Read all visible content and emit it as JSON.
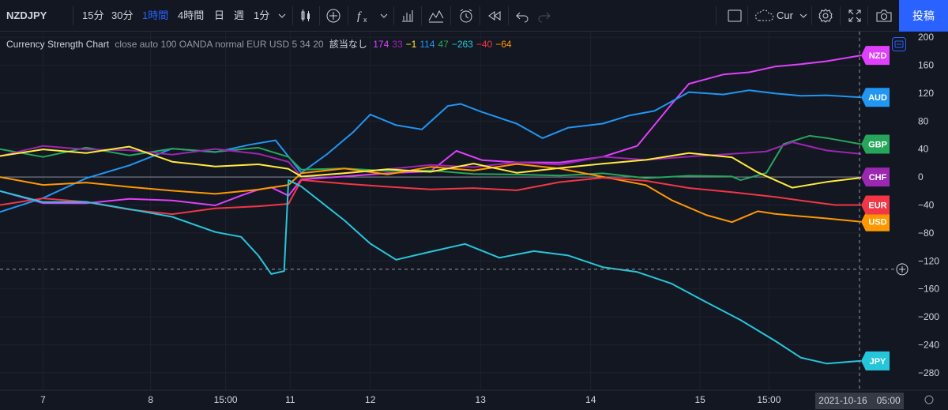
{
  "toolbar": {
    "symbol": "NZDJPY",
    "intervals": [
      "15分",
      "30分",
      "1時間",
      "4時間",
      "日",
      "週",
      "1分"
    ],
    "active_interval": "1時間",
    "cloud_label": "Cur",
    "post_label": "投稿",
    "icons": [
      "candles-icon",
      "add-indicator-icon",
      "fx-icon",
      "bar-chart-icon",
      "compare-icon",
      "alert-icon",
      "replay-icon",
      "undo-icon",
      "redo-icon",
      "layout-icon",
      "cloud-icon",
      "settings-icon",
      "fullscreen-icon",
      "camera-icon"
    ]
  },
  "legend": {
    "title": "Currency Strength Chart",
    "params": "close auto 100 OANDA normal EUR USD 5 34 20",
    "na": "該当なし",
    "values": [
      {
        "text": "174",
        "color": "#e040fb"
      },
      {
        "text": "33",
        "color": "#9c27b0"
      },
      {
        "text": "−1",
        "color": "#ffeb3b"
      },
      {
        "text": "114",
        "color": "#2196f3"
      },
      {
        "text": "47",
        "color": "#26a65b"
      },
      {
        "text": "−263",
        "color": "#26c6da"
      },
      {
        "text": "−40",
        "color": "#f23645"
      },
      {
        "text": "−64",
        "color": "#ff9800"
      }
    ]
  },
  "chart_data": {
    "type": "line",
    "ylim": [
      -305,
      208
    ],
    "yticks": [
      200,
      160,
      120,
      80,
      40,
      0,
      -40,
      -80,
      -120,
      -160,
      -200,
      -240,
      -280
    ],
    "xticks": [
      {
        "label": "7",
        "pos": 0.05
      },
      {
        "label": "8",
        "pos": 0.175
      },
      {
        "label": "15:00",
        "pos": 0.262
      },
      {
        "label": "11",
        "pos": 0.337
      },
      {
        "label": "12",
        "pos": 0.43
      },
      {
        "label": "13",
        "pos": 0.558
      },
      {
        "label": "14",
        "pos": 0.686
      },
      {
        "label": "15",
        "pos": 0.813
      },
      {
        "label": "15:00",
        "pos": 0.893
      }
    ],
    "crosshair": {
      "price": "−132",
      "time": "2021-10-16　05:00"
    },
    "series": [
      {
        "name": "NZD",
        "color": "#e040fb",
        "anchor": 168,
        "label_y": 174,
        "x": [
          0,
          0.05,
          0.1,
          0.15,
          0.2,
          0.25,
          0.28,
          0.3,
          0.315,
          0.335,
          0.35,
          0.4,
          0.45,
          0.5,
          0.53,
          0.56,
          0.6,
          0.65,
          0.7,
          0.74,
          0.78,
          0.8,
          0.84,
          0.87,
          0.9,
          0.93,
          0.96,
          1
        ],
        "values": [
          -20,
          -38,
          -40,
          -35,
          -38,
          -45,
          -30,
          -20,
          -15,
          -25,
          0,
          5,
          10,
          12,
          40,
          25,
          20,
          18,
          25,
          40,
          100,
          130,
          145,
          150,
          160,
          165,
          170,
          174
        ]
      },
      {
        "name": "AUD",
        "color": "#2196f3",
        "anchor": 114,
        "label_y": 114,
        "x": [
          0,
          0.05,
          0.1,
          0.15,
          0.2,
          0.25,
          0.29,
          0.32,
          0.335,
          0.35,
          0.38,
          0.41,
          0.43,
          0.46,
          0.49,
          0.52,
          0.535,
          0.56,
          0.6,
          0.63,
          0.66,
          0.7,
          0.73,
          0.76,
          0.8,
          0.84,
          0.87,
          0.9,
          0.93,
          0.96,
          1
        ],
        "values": [
          -50,
          -30,
          0,
          20,
          45,
          40,
          50,
          55,
          30,
          5,
          30,
          60,
          85,
          70,
          65,
          100,
          105,
          95,
          80,
          60,
          75,
          80,
          90,
          95,
          120,
          115,
          120,
          115,
          112,
          114,
          114
        ]
      },
      {
        "name": "GBP",
        "color": "#26a65b",
        "anchor": 47,
        "label_y": 47,
        "x": [
          0,
          0.05,
          0.1,
          0.15,
          0.2,
          0.25,
          0.3,
          0.335,
          0.35,
          0.4,
          0.45,
          0.5,
          0.55,
          0.6,
          0.65,
          0.7,
          0.75,
          0.8,
          0.85,
          0.86,
          0.89,
          0.91,
          0.94,
          0.96,
          1
        ],
        "values": [
          40,
          30,
          45,
          35,
          45,
          40,
          45,
          30,
          10,
          10,
          5,
          5,
          0,
          0,
          0,
          5,
          0,
          5,
          5,
          0,
          10,
          50,
          60,
          55,
          47
        ]
      },
      {
        "name": "CHF",
        "color": "#9c27b0",
        "anchor": 33,
        "label_y": 0,
        "x": [
          0,
          0.05,
          0.1,
          0.15,
          0.2,
          0.25,
          0.3,
          0.335,
          0.35,
          0.4,
          0.45,
          0.5,
          0.55,
          0.6,
          0.65,
          0.7,
          0.75,
          0.8,
          0.85,
          0.89,
          0.92,
          0.96,
          1
        ],
        "values": [
          30,
          40,
          35,
          35,
          30,
          40,
          35,
          25,
          5,
          10,
          15,
          20,
          15,
          20,
          15,
          25,
          20,
          25,
          30,
          35,
          50,
          40,
          33
        ]
      },
      {
        "name": "USD",
        "color": "#ff9800",
        "anchor": -64,
        "label_y": -64,
        "x": [
          0,
          0.05,
          0.1,
          0.15,
          0.2,
          0.25,
          0.3,
          0.335,
          0.35,
          0.4,
          0.45,
          0.5,
          0.55,
          0.6,
          0.65,
          0.7,
          0.75,
          0.78,
          0.82,
          0.85,
          0.88,
          0.9,
          0.93,
          0.96,
          1
        ],
        "values": [
          0,
          -10,
          -5,
          -10,
          -15,
          -20,
          -15,
          -10,
          5,
          10,
          0,
          10,
          5,
          15,
          10,
          0,
          -10,
          -30,
          -50,
          -60,
          -45,
          -50,
          -55,
          -60,
          -64
        ]
      },
      {
        "name": "EUR",
        "color": "#f23645",
        "anchor": -40,
        "label_y": -40,
        "x": [
          0,
          0.05,
          0.1,
          0.15,
          0.2,
          0.25,
          0.3,
          0.335,
          0.35,
          0.4,
          0.45,
          0.5,
          0.55,
          0.6,
          0.65,
          0.7,
          0.75,
          0.8,
          0.85,
          0.9,
          0.94,
          0.97,
          1
        ],
        "values": [
          -40,
          -35,
          -40,
          -50,
          -55,
          -45,
          -40,
          -35,
          0,
          -5,
          -10,
          -15,
          -15,
          -20,
          -10,
          -5,
          -10,
          -20,
          -25,
          -30,
          -35,
          -38,
          -40
        ]
      },
      {
        "name": "JPY",
        "color": "#26c6da",
        "anchor": -263,
        "label_y": -263,
        "x": [
          0,
          0.05,
          0.1,
          0.15,
          0.2,
          0.25,
          0.28,
          0.3,
          0.315,
          0.33,
          0.335,
          0.35,
          0.4,
          0.43,
          0.46,
          0.5,
          0.54,
          0.58,
          0.62,
          0.66,
          0.7,
          0.74,
          0.78,
          0.82,
          0.86,
          0.9,
          0.93,
          0.96,
          1
        ],
        "values": [
          -20,
          -40,
          -40,
          -50,
          -60,
          -80,
          -85,
          -110,
          -135,
          -130,
          0,
          -10,
          -60,
          -95,
          -120,
          -110,
          -100,
          -120,
          -110,
          -115,
          -130,
          -135,
          -150,
          -175,
          -200,
          -230,
          -255,
          -265,
          -263
        ]
      },
      {
        "name": "",
        "color": "#ffeb3b",
        "anchor": -1,
        "label_y": null,
        "x": [
          0,
          0.05,
          0.1,
          0.15,
          0.2,
          0.25,
          0.3,
          0.335,
          0.35,
          0.4,
          0.45,
          0.5,
          0.55,
          0.6,
          0.65,
          0.7,
          0.75,
          0.8,
          0.85,
          0.88,
          0.92,
          0.96,
          1
        ],
        "values": [
          30,
          35,
          30,
          40,
          20,
          15,
          20,
          15,
          5,
          10,
          15,
          10,
          20,
          5,
          10,
          15,
          20,
          30,
          25,
          5,
          -15,
          -5,
          -1
        ]
      }
    ]
  }
}
